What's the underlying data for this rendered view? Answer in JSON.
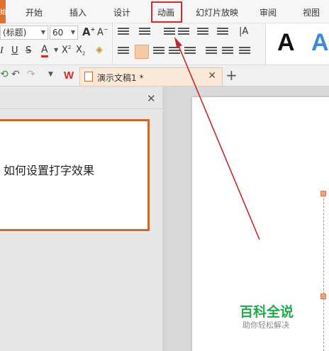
{
  "menu": {
    "left_tab": "始",
    "items": [
      "开始",
      "插入",
      "设计",
      "动画",
      "幻灯片放映",
      "审阅",
      "视图"
    ],
    "highlighted": "动画"
  },
  "ribbon": {
    "font_name": "(标题)",
    "font_size": "60",
    "format_buttons": [
      "I",
      "U",
      "S",
      "A"
    ]
  },
  "tabbar": {
    "doc_title": "演示文稿1 *",
    "new_tab": "+"
  },
  "slide_thumb": {
    "text": "如何设置打字效果"
  },
  "watermark": {
    "title": "百科全说",
    "subtitle": "助你轻松解决"
  },
  "colors": {
    "accent": "#e0702b",
    "highlight_box": "#d42a2a",
    "arrow": "#c62828",
    "watermark": "#22a94a"
  }
}
